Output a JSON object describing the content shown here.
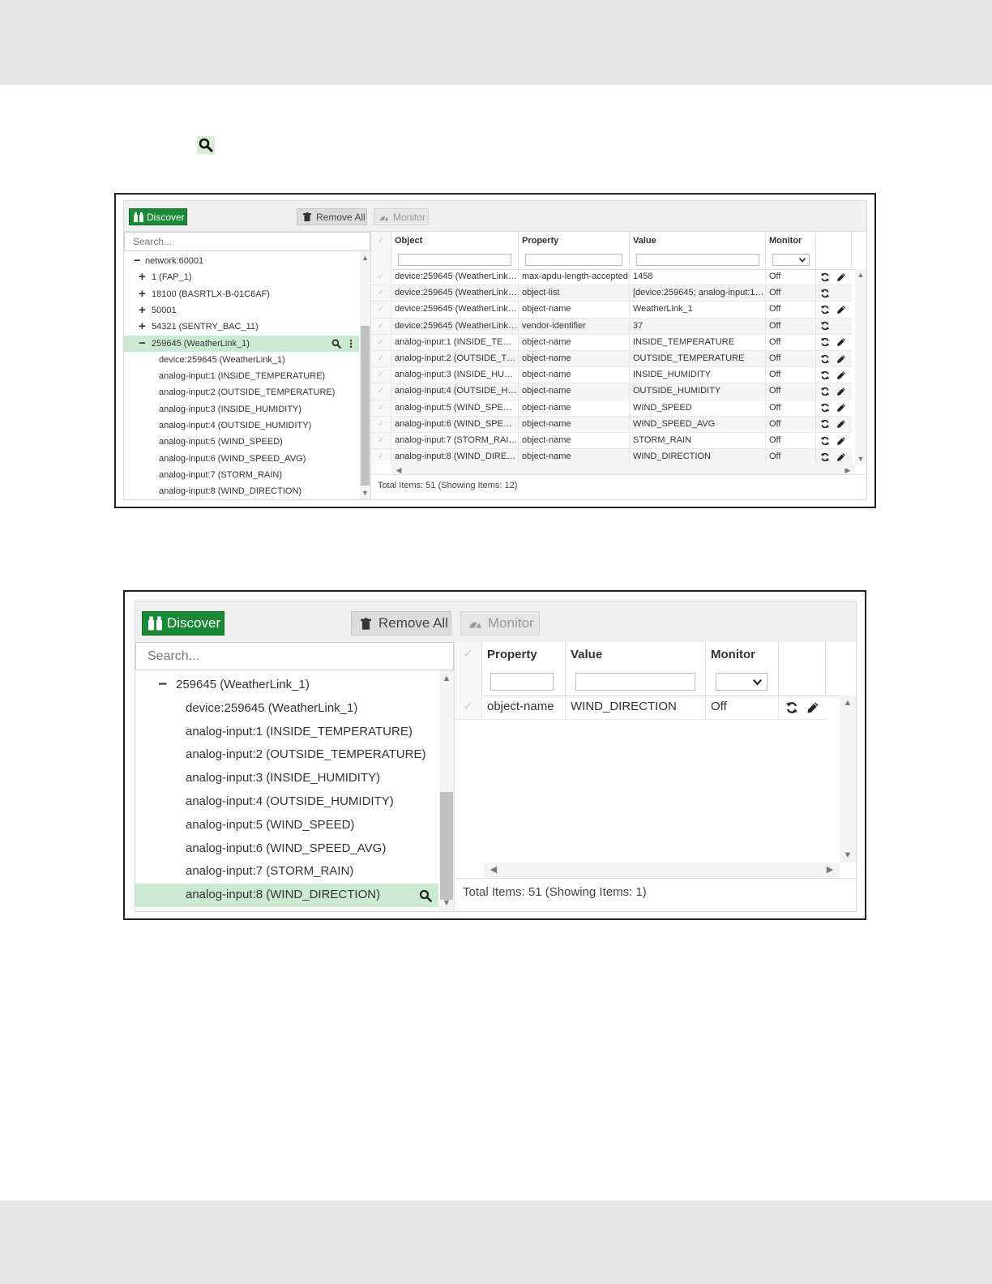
{
  "colors": {
    "discover_green": "#1a8a34",
    "selected_row": "#cce9d2",
    "band_gray": "#e6e6e6"
  },
  "icons": {
    "inline_search": "magnifier-icon",
    "discover": "binoculars-icon",
    "remove_all": "trash-icon",
    "monitor": "gauge-icon",
    "refresh": "refresh-icon",
    "edit": "pencil-icon",
    "kebab": "kebab-menu-icon"
  },
  "toolbar": {
    "discover_label": "Discover",
    "remove_all_label": "Remove All",
    "monitor_label": "Monitor"
  },
  "tree": {
    "search_placeholder": "Search..."
  },
  "shot1": {
    "tree_nodes": [
      {
        "label": "network:60001",
        "toggle": "−"
      },
      {
        "label": "1 (FAP_1)",
        "toggle": "+"
      },
      {
        "label": "18100 (BASRTLX-B-01C6AF)",
        "toggle": "+"
      },
      {
        "label": "50001",
        "toggle": "+"
      },
      {
        "label": "54321 (SENTRY_BAC_11)",
        "toggle": "+"
      },
      {
        "label": "259645 (WeatherLink_1)",
        "toggle": "−"
      },
      {
        "label": "device:259645 (WeatherLink_1)",
        "toggle": ""
      },
      {
        "label": "analog-input:1 (INSIDE_TEMPERATURE)",
        "toggle": ""
      },
      {
        "label": "analog-input:2 (OUTSIDE_TEMPERATURE)",
        "toggle": ""
      },
      {
        "label": "analog-input:3 (INSIDE_HUMIDITY)",
        "toggle": ""
      },
      {
        "label": "analog-input:4 (OUTSIDE_HUMIDITY)",
        "toggle": ""
      },
      {
        "label": "analog-input:5 (WIND_SPEED)",
        "toggle": ""
      },
      {
        "label": "analog-input:6 (WIND_SPEED_AVG)",
        "toggle": ""
      },
      {
        "label": "analog-input:7 (STORM_RAIN)",
        "toggle": ""
      },
      {
        "label": "analog-input:8 (WIND_DIRECTION)",
        "toggle": ""
      }
    ],
    "columns": {
      "object": "Object",
      "property": "Property",
      "value": "Value",
      "monitor": "Monitor"
    },
    "rows": [
      {
        "object": "device:259645 (WeatherLink_1)",
        "property": "max-apdu-length-accepted",
        "value": "1458",
        "monitor": "Off",
        "edit": true
      },
      {
        "object": "device:259645 (WeatherLink_1)",
        "property": "object-list",
        "value": "[device:259645; analog-input:1; an…",
        "monitor": "Off",
        "edit": false
      },
      {
        "object": "device:259645 (WeatherLink_1)",
        "property": "object-name",
        "value": "WeatherLink_1",
        "monitor": "Off",
        "edit": true
      },
      {
        "object": "device:259645 (WeatherLink_1)",
        "property": "vendor-identifier",
        "value": "37",
        "monitor": "Off",
        "edit": false
      },
      {
        "object": "analog-input:1 (INSIDE_TEMPE…",
        "property": "object-name",
        "value": "INSIDE_TEMPERATURE",
        "monitor": "Off",
        "edit": true
      },
      {
        "object": "analog-input:2 (OUTSIDE_TEM…",
        "property": "object-name",
        "value": "OUTSIDE_TEMPERATURE",
        "monitor": "Off",
        "edit": true
      },
      {
        "object": "analog-input:3 (INSIDE_HUMIDI…",
        "property": "object-name",
        "value": "INSIDE_HUMIDITY",
        "monitor": "Off",
        "edit": true
      },
      {
        "object": "analog-input:4 (OUTSIDE_HUMI…",
        "property": "object-name",
        "value": "OUTSIDE_HUMIDITY",
        "monitor": "Off",
        "edit": true
      },
      {
        "object": "analog-input:5 (WIND_SPEED)",
        "property": "object-name",
        "value": "WIND_SPEED",
        "monitor": "Off",
        "edit": true
      },
      {
        "object": "analog-input:6 (WIND_SPEED_A…",
        "property": "object-name",
        "value": "WIND_SPEED_AVG",
        "monitor": "Off",
        "edit": true
      },
      {
        "object": "analog-input:7 (STORM_RAIN)",
        "property": "object-name",
        "value": "STORM_RAIN",
        "monitor": "Off",
        "edit": true
      },
      {
        "object": "analog-input:8 (WIND_DIRECTI…",
        "property": "object-name",
        "value": "WIND_DIRECTION",
        "monitor": "Off",
        "edit": true
      }
    ],
    "footer": "Total Items: 51 (Showing Items: 12)"
  },
  "shot2": {
    "tree_nodes": [
      {
        "label": "259645 (WeatherLink_1)",
        "toggle": "−"
      },
      {
        "label": "device:259645 (WeatherLink_1)",
        "toggle": ""
      },
      {
        "label": "analog-input:1 (INSIDE_TEMPERATURE)",
        "toggle": ""
      },
      {
        "label": "analog-input:2 (OUTSIDE_TEMPERATURE)",
        "toggle": ""
      },
      {
        "label": "analog-input:3 (INSIDE_HUMIDITY)",
        "toggle": ""
      },
      {
        "label": "analog-input:4 (OUTSIDE_HUMIDITY)",
        "toggle": ""
      },
      {
        "label": "analog-input:5 (WIND_SPEED)",
        "toggle": ""
      },
      {
        "label": "analog-input:6 (WIND_SPEED_AVG)",
        "toggle": ""
      },
      {
        "label": "analog-input:7 (STORM_RAIN)",
        "toggle": ""
      },
      {
        "label": "analog-input:8 (WIND_DIRECTION)",
        "toggle": ""
      }
    ],
    "columns": {
      "property": "Property",
      "value": "Value",
      "monitor": "Monitor"
    },
    "rows": [
      {
        "property": "object-name",
        "value": "WIND_DIRECTION",
        "monitor": "Off",
        "edit": true
      }
    ],
    "footer": "Total Items: 51 (Showing Items: 1)"
  }
}
